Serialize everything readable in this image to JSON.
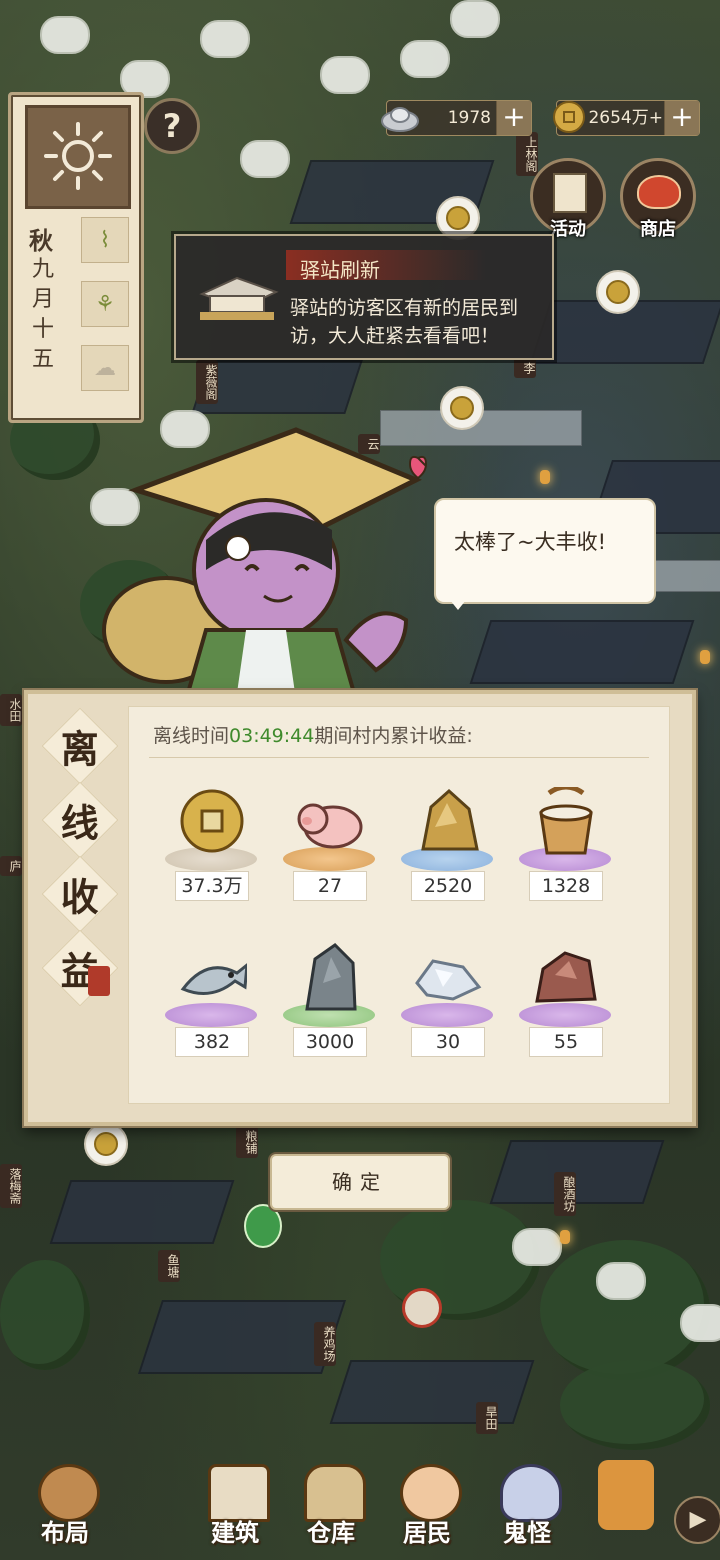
{
  "hud": {
    "silver": "1978",
    "copper": "2654万+",
    "activity_label": "活动",
    "shop_label": "商店"
  },
  "calendar": {
    "season": "秋",
    "date_chars": [
      "九",
      "月",
      "十",
      "五"
    ]
  },
  "notice": {
    "title": "驿站刷新",
    "body": "驿站的访客区有新的居民到访，大人赶紧去看看吧！"
  },
  "character": {
    "speech": "太棒了~大丰收!"
  },
  "offline_panel": {
    "title_chars": [
      "离",
      "线",
      "收",
      "益"
    ],
    "line_prefix": "离线时间",
    "time": "03:49:44",
    "line_suffix": "期间村内累计收益:",
    "items": [
      {
        "icon": "copper-coin-icon",
        "count": "37.3万",
        "rarity": "gray"
      },
      {
        "icon": "pig-icon",
        "count": "27",
        "rarity": "orange"
      },
      {
        "icon": "gold-ore-icon",
        "count": "2520",
        "rarity": "blue"
      },
      {
        "icon": "wooden-bucket-icon",
        "count": "1328",
        "rarity": "purple"
      },
      {
        "icon": "fish-icon",
        "count": "382",
        "rarity": "purple"
      },
      {
        "icon": "stone-icon",
        "count": "3000",
        "rarity": "green"
      },
      {
        "icon": "crystal-ore-icon",
        "count": "30",
        "rarity": "purple"
      },
      {
        "icon": "red-ore-icon",
        "count": "55",
        "rarity": "purple"
      }
    ],
    "confirm": "确定"
  },
  "map_tags": [
    "上林阁",
    "紫薇阁",
    "水田",
    "粮铺",
    "鱼塘",
    "养鸡场",
    "落梅斋",
    "酿酒坊",
    "旱田",
    "庐",
    "李",
    "云"
  ],
  "bottom_nav": [
    {
      "label": "布局",
      "icon": "layout-icon"
    },
    {
      "label": "建筑",
      "icon": "building-icon"
    },
    {
      "label": "仓库",
      "icon": "warehouse-icon"
    },
    {
      "label": "居民",
      "icon": "residents-icon"
    },
    {
      "label": "鬼怪",
      "icon": "ghost-icon"
    }
  ]
}
